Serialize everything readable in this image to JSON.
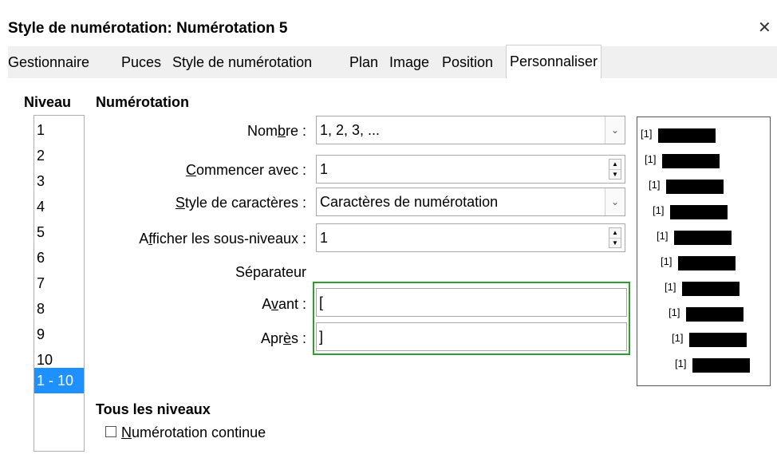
{
  "window": {
    "title": "Style de numérotation: Numérotation 5",
    "close_label": "✕"
  },
  "tabs": [
    {
      "label": "Gestionnaire",
      "active": false
    },
    {
      "label": "Puces",
      "active": false
    },
    {
      "label": "Style de numérotation",
      "active": false
    },
    {
      "label": "Plan",
      "active": false
    },
    {
      "label": "Image",
      "active": false
    },
    {
      "label": "Position",
      "active": false
    },
    {
      "label": "Personnaliser",
      "active": true
    }
  ],
  "level": {
    "header": "Niveau",
    "items": [
      "1",
      "2",
      "3",
      "4",
      "5",
      "6",
      "7",
      "8",
      "9",
      "10",
      "1 - 10"
    ],
    "selected": "1 - 10"
  },
  "numbering": {
    "header": "Numérotation",
    "number": {
      "label_pre": "Nom",
      "label_u": "b",
      "label_post": "re :",
      "value": "1, 2, 3, ..."
    },
    "start_with": {
      "label_pre": "",
      "label_u": "C",
      "label_post": "ommencer avec :",
      "value": "1"
    },
    "char_style": {
      "label_pre": "",
      "label_u": "S",
      "label_post": "tyle de caractères :",
      "value": "Caractères de numérotation"
    },
    "show_sublevels": {
      "label_pre": "A",
      "label_u": "f",
      "label_post": "ficher les sous-niveaux :",
      "value": "1"
    },
    "separator_label": "Séparateur",
    "before": {
      "label_pre": "A",
      "label_u": "v",
      "label_post": "ant :",
      "value": "["
    },
    "after": {
      "label_pre": "Apr",
      "label_u": "è",
      "label_post": "s :",
      "value": "]"
    }
  },
  "all_levels": {
    "header": "Tous les niveaux",
    "continuous": {
      "label_u": "N",
      "label_post": "umérotation continue",
      "checked": false
    }
  },
  "preview": {
    "item_label": "[1]",
    "count": 10
  }
}
